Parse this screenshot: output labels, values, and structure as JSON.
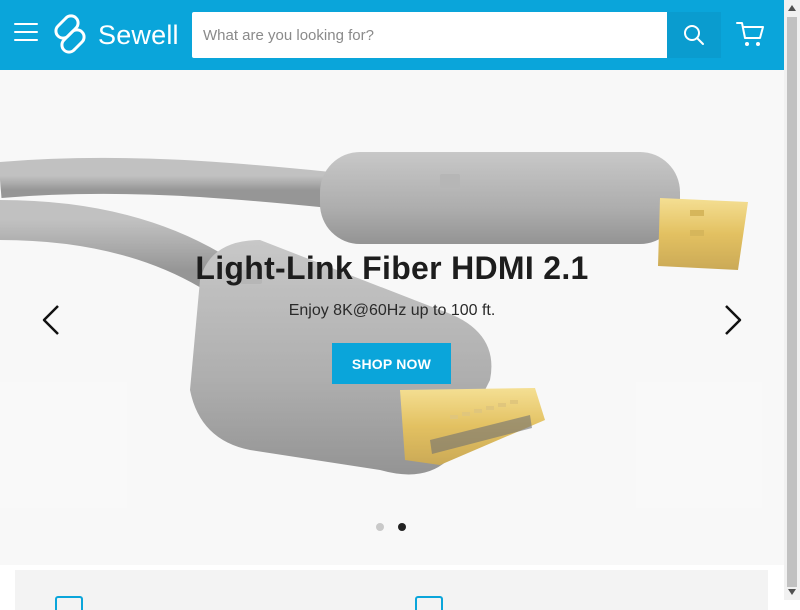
{
  "header": {
    "logo_text": "Sewell",
    "search_placeholder": "What are you looking for?"
  },
  "hero": {
    "title": "Light-Link Fiber HDMI 2.1",
    "subtitle": "Enjoy 8K@60Hz up to 100 ft.",
    "cta_label": "SHOP NOW",
    "slide_count": 2,
    "active_slide": 2
  },
  "icons": {
    "menu": "hamburger-menu-icon",
    "logo": "sewell-logo-icon",
    "search": "search-icon",
    "cart": "cart-icon",
    "prev": "chevron-left-icon",
    "next": "chevron-right-icon"
  },
  "colors": {
    "brand": "#0aa5da",
    "header_bg": "#0aa5da",
    "button_bg": "#0aa5da",
    "dot_active": "#222222",
    "dot_inactive": "#c9c9c9"
  }
}
